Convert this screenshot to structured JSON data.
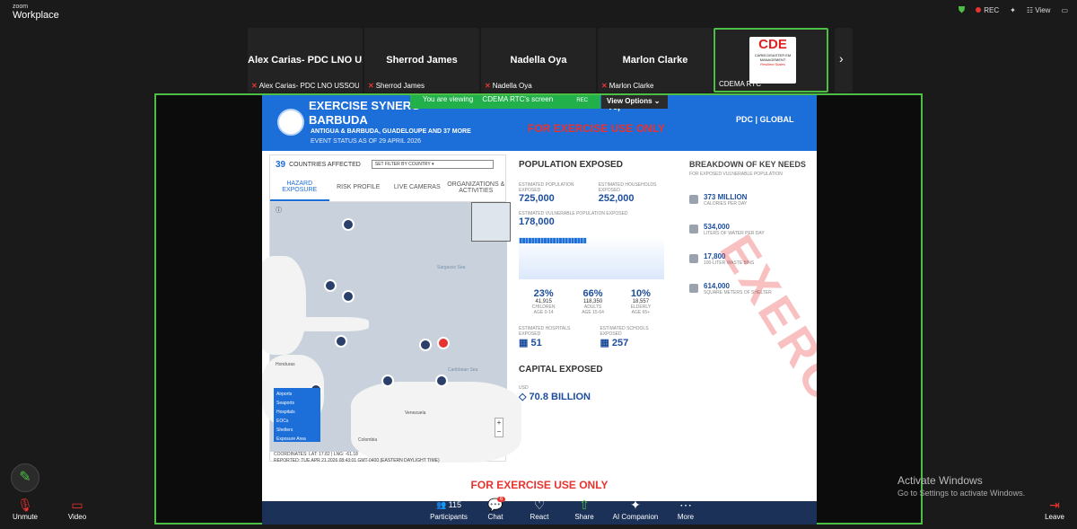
{
  "app": {
    "brand_small": "zoom",
    "brand": "Workplace",
    "rec": "REC",
    "view": "View"
  },
  "participants": [
    {
      "name": "Alex Carias- PDC LNO U...",
      "label": "Alex Carias- PDC LNO USSOUT..."
    },
    {
      "name": "Sherrod James",
      "label": "Sherrod James"
    },
    {
      "name": "Nadella Oya",
      "label": "Nadella Oya"
    },
    {
      "name": "Marlon Clarke",
      "label": "Marlon Clarke"
    },
    {
      "name": "CDEMA RTC",
      "label": "CDEMA RTC",
      "logo": "CDE",
      "logo_sub": "CARIB DISASTER EM MANAGEMENT",
      "logo_tag": "Resilient States"
    }
  ],
  "share_bar": {
    "viewing": "You are viewing",
    "screen": "CDEMA RTC's screen",
    "rec": "REC",
    "view_options": "View Options"
  },
  "doc": {
    "title1": "EXERCISE SYNERG",
    "title1_tail": "N,",
    "title2": "BARBUDA",
    "subtitle": "ANTIGUA & BARBUDA, GUADELOUPE AND 37 MORE",
    "status": "EVENT STATUS AS OF 29 APRIL 2026",
    "few": "FOR EXERCISE USE ONLY",
    "pdc": "PDC | GLOBAL",
    "watermark": "EXERCISE",
    "countries": "39",
    "countries_label": "COUNTRIES AFFECTED",
    "filter": "SET FILTER BY COUNTRY",
    "tabs": [
      "HAZARD EXPOSURE",
      "RISK PROFILE",
      "LIVE CAMERAS",
      "ORGANIZATIONS & ACTIVITIES"
    ],
    "legend": [
      "Airports",
      "Seaports",
      "Hospitals",
      "EOCs",
      "Shelters",
      "Exposure Area"
    ],
    "map_labels": [
      "Caribbean Sea",
      "Venezuela",
      "Colombia",
      "Honduras",
      "Sargasso Sea"
    ],
    "coords": "COORDINATES: LAT: 17.82 | LNG: -61.18",
    "reported": "REPORTED: TUE APR 21 2026 08:43:01 GMT-0400 (EASTERN DAYLIGHT TIME)",
    "pop": {
      "title": "POPULATION EXPOSED",
      "est_pop_label": "ESTIMATED POPULATION EXPOSED",
      "est_pop": "725,000",
      "est_hh_label": "ESTIMATED HOUSEHOLDS EXPOSED",
      "est_hh": "252,000",
      "vuln_label": "ESTIMATED VULNERABLE POPULATION EXPOSED",
      "vuln": "178,000",
      "groups": [
        {
          "pct": "23%",
          "num": "41,915",
          "lbl": "CHILDREN",
          "age": "AGE 0-14"
        },
        {
          "pct": "66%",
          "num": "118,350",
          "lbl": "ADULTS",
          "age": "AGE 15-64"
        },
        {
          "pct": "10%",
          "num": "18,557",
          "lbl": "ELDERLY",
          "age": "AGE 65+"
        }
      ],
      "hosp_label": "ESTIMATED HOSPITALS EXPOSED",
      "hosp": "51",
      "school_label": "ESTIMATED SCHOOLS EXPOSED",
      "school": "257"
    },
    "capital": {
      "title": "CAPITAL EXPOSED",
      "unit": "USD",
      "value": "70.8 BILLION"
    },
    "needs": {
      "title": "BREAKDOWN OF KEY NEEDS",
      "sub": "FOR EXPOSED VULNERABLE POPULATION",
      "items": [
        {
          "v": "373 MILLION",
          "l": "CALORIES PER DAY"
        },
        {
          "v": "534,000",
          "l": "LITERS OF WATER PER DAY"
        },
        {
          "v": "17,800",
          "l": "100-LITER WASTE BINS"
        },
        {
          "v": "614,000",
          "l": "SQUARE METERS OF SHELTER"
        }
      ]
    }
  },
  "toolbar": {
    "unmute": "Unmute",
    "video": "Video",
    "participants": "Participants",
    "count": "115",
    "chat": "Chat",
    "chat_badge": "6",
    "react": "React",
    "share": "Share",
    "ai": "AI Companion",
    "more": "More",
    "leave": "Leave"
  },
  "windows": {
    "line1": "Activate Windows",
    "line2": "Go to Settings to activate Windows."
  }
}
